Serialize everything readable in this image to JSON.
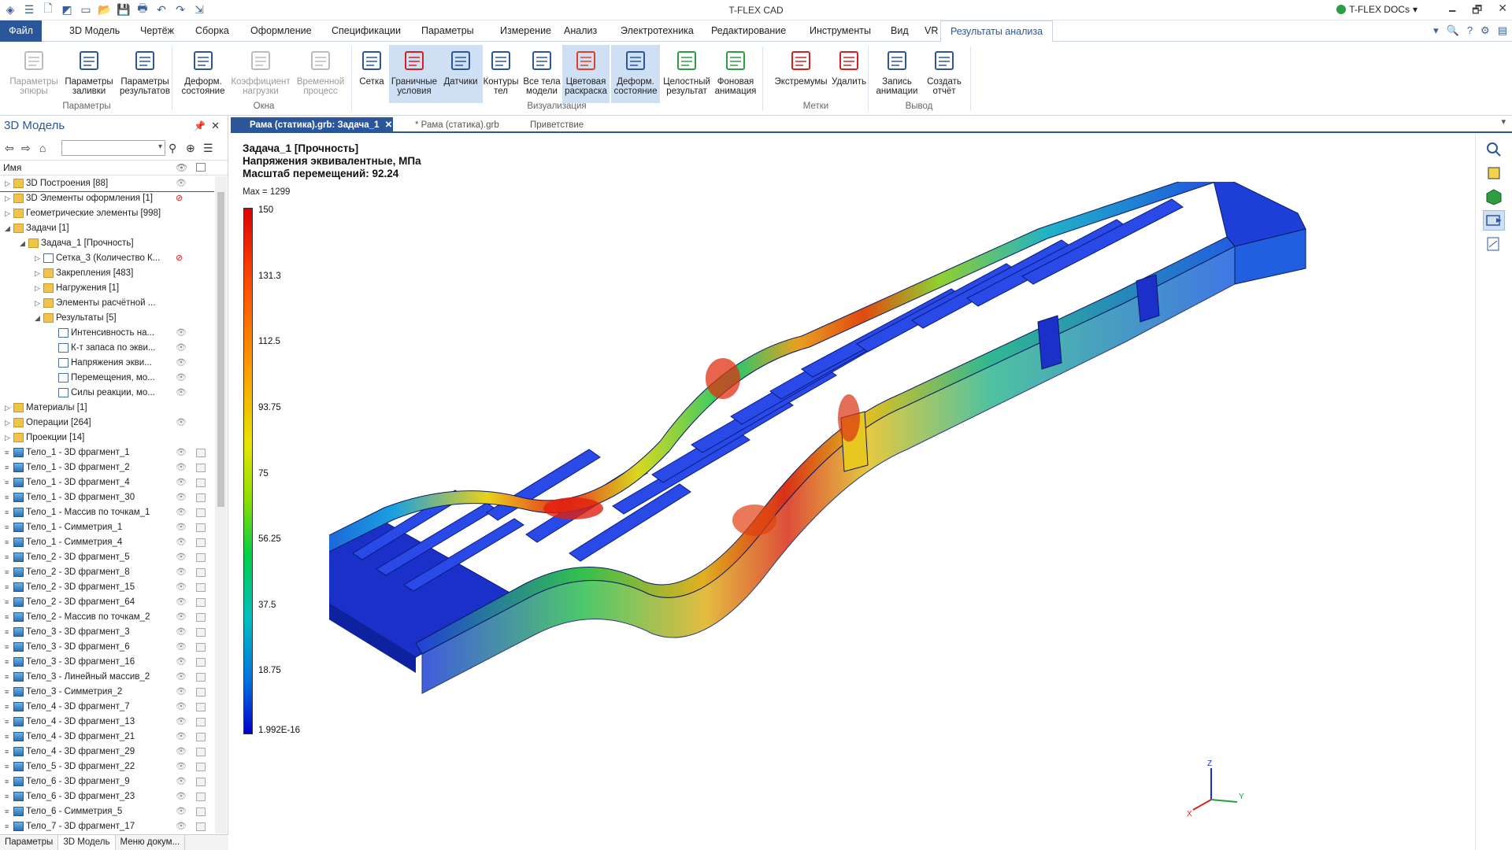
{
  "titlebar": {
    "app_title": "T-FLEX CAD",
    "docs_label": "T-FLEX DOCs",
    "docs_arrow": "▾",
    "minimize": "🗕",
    "restore": "🗗",
    "close": "✕"
  },
  "menu": {
    "file": "Файл",
    "tabs": [
      "3D Модель",
      "Чертёж",
      "Сборка",
      "Оформление",
      "Спецификации",
      "Параметры",
      "Измерение",
      "Анализ",
      "Электротехника",
      "Редактирование",
      "Инструменты",
      "Вид",
      "VR",
      "Результаты анализа"
    ],
    "active_tab": "Результаты анализа"
  },
  "ribbon": {
    "buttons": [
      {
        "l1": "Параметры",
        "l2": "эпюры",
        "state": "disabled"
      },
      {
        "l1": "Параметры",
        "l2": "заливки",
        "state": "normal"
      },
      {
        "l1": "Параметры",
        "l2": "результатов",
        "state": "normal"
      },
      {
        "l1": "Деформ.",
        "l2": "состояние",
        "state": "normal"
      },
      {
        "l1": "Коэффициент",
        "l2": "нагрузки",
        "state": "disabled"
      },
      {
        "l1": "Временной",
        "l2": "процесс",
        "state": "disabled"
      },
      {
        "l1": "Сетка",
        "l2": "",
        "state": "normal"
      },
      {
        "l1": "Граничные",
        "l2": "условия",
        "state": "selected"
      },
      {
        "l1": "Датчики",
        "l2": "",
        "state": "selected"
      },
      {
        "l1": "Контуры",
        "l2": "тел",
        "state": "normal"
      },
      {
        "l1": "Все тела",
        "l2": "модели",
        "state": "normal"
      },
      {
        "l1": "Цветовая",
        "l2": "раскраска",
        "state": "selected"
      },
      {
        "l1": "Деформ.",
        "l2": "состояние",
        "state": "selected"
      },
      {
        "l1": "Целостный",
        "l2": "результат",
        "state": "normal"
      },
      {
        "l1": "Фоновая",
        "l2": "анимация",
        "state": "normal"
      },
      {
        "l1": "Экстремумы",
        "l2": "",
        "state": "normal"
      },
      {
        "l1": "Удалить",
        "l2": "",
        "state": "normal"
      },
      {
        "l1": "Запись",
        "l2": "анимации",
        "state": "normal"
      },
      {
        "l1": "Создать",
        "l2": "отчёт",
        "state": "normal"
      }
    ],
    "groups": [
      "Параметры",
      "Окна",
      "Визуализация",
      "Метки",
      "Вывод"
    ]
  },
  "left_panel": {
    "title": "3D Модель",
    "pin": "📌",
    "close": "✕",
    "column_name": "Имя",
    "tree": [
      {
        "label": "3D Построения [88]",
        "level": 0,
        "exp": "▷",
        "icon": "folder",
        "eye": "vis",
        "sel": true
      },
      {
        "label": "3D Элементы оформления [1]",
        "level": 0,
        "exp": "▷",
        "icon": "folder",
        "eye": "hid"
      },
      {
        "label": "Геометрические элементы [998]",
        "level": 0,
        "exp": "▷",
        "icon": "folder",
        "eye": ""
      },
      {
        "label": "Задачи [1]",
        "level": 0,
        "exp": "◢",
        "icon": "task",
        "eye": ""
      },
      {
        "label": "Задача_1 [Прочность]",
        "level": 1,
        "exp": "◢",
        "icon": "task",
        "eye": ""
      },
      {
        "label": "Сетка_3 (Количество К...",
        "level": 2,
        "exp": "▷",
        "icon": "mesh",
        "eye": "hid"
      },
      {
        "label": "Закрепления [483]",
        "level": 2,
        "exp": "▷",
        "icon": "folder",
        "eye": ""
      },
      {
        "label": "Нагружения [1]",
        "level": 2,
        "exp": "▷",
        "icon": "folder",
        "eye": ""
      },
      {
        "label": "Элементы расчётной ...",
        "level": 2,
        "exp": "▷",
        "icon": "folder",
        "eye": ""
      },
      {
        "label": "Результаты [5]",
        "level": 2,
        "exp": "◢",
        "icon": "folder",
        "eye": ""
      },
      {
        "label": "Интенсивность на...",
        "level": 3,
        "exp": "",
        "icon": "doc",
        "eye": "vis"
      },
      {
        "label": "К-т запаса по экви...",
        "level": 3,
        "exp": "",
        "icon": "doc",
        "eye": "vis"
      },
      {
        "label": "Напряжения экви...",
        "level": 3,
        "exp": "",
        "icon": "doc",
        "eye": "vis"
      },
      {
        "label": "Перемещения, мо...",
        "level": 3,
        "exp": "",
        "icon": "doc",
        "eye": "vis"
      },
      {
        "label": "Силы реакции, мо...",
        "level": 3,
        "exp": "",
        "icon": "doc",
        "eye": "vis"
      },
      {
        "label": "Материалы [1]",
        "level": 0,
        "exp": "▷",
        "icon": "folder",
        "eye": ""
      },
      {
        "label": "Операции [264]",
        "level": 0,
        "exp": "▷",
        "icon": "folder",
        "eye": "vis"
      },
      {
        "label": "Проекции [14]",
        "level": 0,
        "exp": "▷",
        "icon": "folder",
        "eye": ""
      },
      {
        "label": "Тело_1 - 3D фрагмент_1",
        "level": 0,
        "exp": "",
        "icon": "body",
        "eye": "vis",
        "cb": true
      },
      {
        "label": "Тело_1 - 3D фрагмент_2",
        "level": 0,
        "exp": "",
        "icon": "body",
        "eye": "vis",
        "cb": true
      },
      {
        "label": "Тело_1 - 3D фрагмент_4",
        "level": 0,
        "exp": "",
        "icon": "body",
        "eye": "vis",
        "cb": true
      },
      {
        "label": "Тело_1 - 3D фрагмент_30",
        "level": 0,
        "exp": "",
        "icon": "body",
        "eye": "vis",
        "cb": true
      },
      {
        "label": "Тело_1 - Массив по точкам_1",
        "level": 0,
        "exp": "",
        "icon": "array",
        "eye": "vis",
        "cb": true
      },
      {
        "label": "Тело_1 - Симметрия_1",
        "level": 0,
        "exp": "",
        "icon": "body",
        "eye": "vis",
        "cb": true
      },
      {
        "label": "Тело_1 - Симметрия_4",
        "level": 0,
        "exp": "",
        "icon": "body",
        "eye": "vis",
        "cb": true
      },
      {
        "label": "Тело_2 - 3D фрагмент_5",
        "level": 0,
        "exp": "",
        "icon": "body",
        "eye": "vis",
        "cb": true
      },
      {
        "label": "Тело_2 - 3D фрагмент_8",
        "level": 0,
        "exp": "",
        "icon": "body",
        "eye": "vis",
        "cb": true
      },
      {
        "label": "Тело_2 - 3D фрагмент_15",
        "level": 0,
        "exp": "",
        "icon": "bodyr",
        "eye": "vis",
        "cb": true
      },
      {
        "label": "Тело_2 - 3D фрагмент_64",
        "level": 0,
        "exp": "",
        "icon": "body",
        "eye": "vis",
        "cb": true
      },
      {
        "label": "Тело_2 - Массив по точкам_2",
        "level": 0,
        "exp": "",
        "icon": "array",
        "eye": "vis",
        "cb": true
      },
      {
        "label": "Тело_3 - 3D фрагмент_3",
        "level": 0,
        "exp": "",
        "icon": "body",
        "eye": "vis",
        "cb": true
      },
      {
        "label": "Тело_3 - 3D фрагмент_6",
        "level": 0,
        "exp": "",
        "icon": "body",
        "eye": "vis",
        "cb": true
      },
      {
        "label": "Тело_3 - 3D фрагмент_16",
        "level": 0,
        "exp": "",
        "icon": "body",
        "eye": "vis",
        "cb": true
      },
      {
        "label": "Тело_3 - Линейный массив_2",
        "level": 0,
        "exp": "",
        "icon": "linear",
        "eye": "vis",
        "cb": true
      },
      {
        "label": "Тело_3 - Симметрия_2",
        "level": 0,
        "exp": "",
        "icon": "sym",
        "eye": "vis",
        "cb": true
      },
      {
        "label": "Тело_4 - 3D фрагмент_7",
        "level": 0,
        "exp": "",
        "icon": "body",
        "eye": "vis",
        "cb": true
      },
      {
        "label": "Тело_4 - 3D фрагмент_13",
        "level": 0,
        "exp": "",
        "icon": "body",
        "eye": "vis",
        "cb": true
      },
      {
        "label": "Тело_4 - 3D фрагмент_21",
        "level": 0,
        "exp": "",
        "icon": "body",
        "eye": "vis",
        "cb": true
      },
      {
        "label": "Тело_4 - 3D фрагмент_29",
        "level": 0,
        "exp": "",
        "icon": "bodyr",
        "eye": "vis",
        "cb": true
      },
      {
        "label": "Тело_5 - 3D фрагмент_22",
        "level": 0,
        "exp": "",
        "icon": "body",
        "eye": "vis",
        "cb": true
      },
      {
        "label": "Тело_6 - 3D фрагмент_9",
        "level": 0,
        "exp": "",
        "icon": "body",
        "eye": "vis",
        "cb": true
      },
      {
        "label": "Тело_6 - 3D фрагмент_23",
        "level": 0,
        "exp": "",
        "icon": "body",
        "eye": "vis",
        "cb": true
      },
      {
        "label": "Тело_6 - Симметрия_5",
        "level": 0,
        "exp": "",
        "icon": "sym",
        "eye": "vis",
        "cb": true
      },
      {
        "label": "Тело_7 - 3D фрагмент_17",
        "level": 0,
        "exp": "",
        "icon": "body",
        "eye": "vis",
        "cb": true
      }
    ],
    "bottom_tabs": [
      "Параметры",
      "3D Модель",
      "Меню докум..."
    ]
  },
  "doc_tabs": [
    {
      "label": "Рама (статика).grb: Задача_1",
      "active": true
    },
    {
      "label": "* Рама (статика).grb",
      "active": false
    },
    {
      "label": "Приветствие",
      "active": false
    }
  ],
  "viewport": {
    "title_line1": "Задача_1 [Прочность]",
    "title_line2": "Напряжения эквивалентные, МПа",
    "title_line3": "Масштаб перемещений: 92.24",
    "max_label": "Max = 1299",
    "legend_values": [
      "150",
      "131.3",
      "112.5",
      "93.75",
      "75",
      "56.25",
      "37.5",
      "18.75",
      "1.992E-16"
    ],
    "axis_labels": {
      "z": "Z",
      "x": "X",
      "y": "Y"
    }
  },
  "colors": {
    "accent": "#2b579a",
    "selected": "#cfe0f5"
  }
}
